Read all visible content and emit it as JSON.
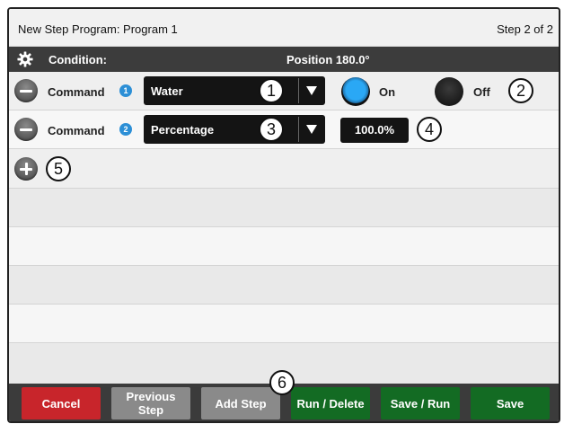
{
  "header": {
    "title": "New Step Program:  Program 1",
    "step_indicator": "Step 2 of 2"
  },
  "condition": {
    "icon": "gear-icon",
    "label": "Condition:",
    "value": "Position 180.0°"
  },
  "commands": [
    {
      "label": "Command",
      "badge": "1",
      "dropdown_value": "Water",
      "on_label": "On",
      "off_label": "Off",
      "selected": "On"
    },
    {
      "label": "Command",
      "badge": "2",
      "dropdown_value": "Percentage",
      "value": "100.0%"
    }
  ],
  "callouts": [
    "1",
    "2",
    "3",
    "4",
    "5",
    "6"
  ],
  "footer": {
    "cancel": "Cancel",
    "previous_step": "Previous Step",
    "add_step": "Add Step",
    "run_delete": "Run / Delete",
    "save_run": "Save / Run",
    "save": "Save"
  },
  "colors": {
    "accent_blue": "#2aa8f5",
    "cancel_red": "#c8252b",
    "save_green": "#136b23",
    "button_gray": "#8a8a8a",
    "bar_dark": "#3c3c3c"
  }
}
